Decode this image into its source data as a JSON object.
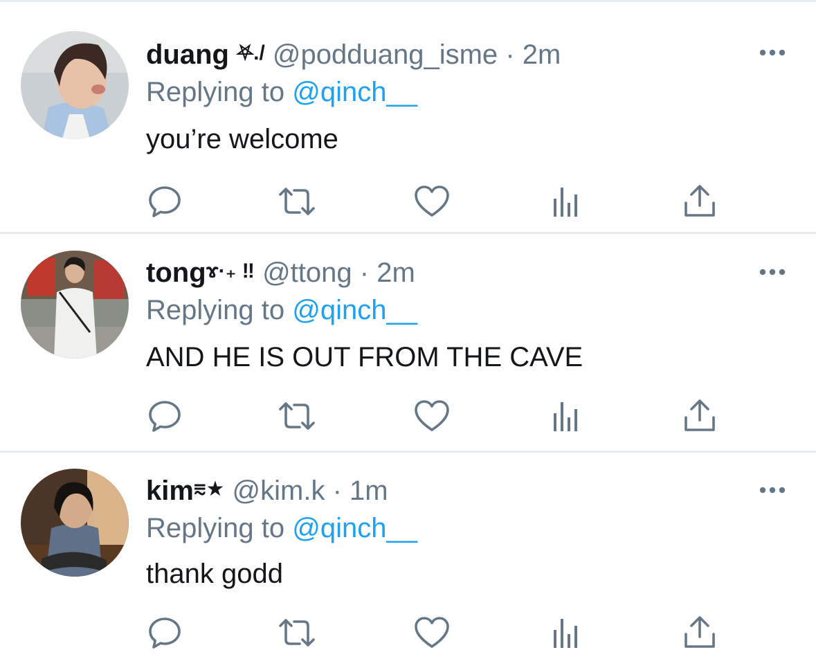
{
  "replying_prefix": "Replying to ",
  "colors": {
    "link": "#1da1f2",
    "secondary": "#657786",
    "primary_text": "#14171a",
    "divider": "#e6ecf0"
  },
  "action_icons": [
    "reply-icon",
    "retweet-icon",
    "like-icon",
    "stats-icon",
    "share-icon"
  ],
  "tweets": [
    {
      "name": "duang",
      "name_decoration": "⛧./",
      "handle": "@podduang_isme",
      "separator": "·",
      "time": "2m",
      "replying_to": "@qinch__",
      "text": "you’re welcome"
    },
    {
      "name": "tong",
      "name_decoration": "ɤ·₊ ‼",
      "handle": "@ttong",
      "separator": "·",
      "time": "2m",
      "replying_to": "@qinch__",
      "text": "AND HE IS OUT FROM THE CAVE"
    },
    {
      "name": "kim",
      "name_decoration": "⩳★",
      "handle": "@kim.k",
      "separator": "·",
      "time": "1m",
      "replying_to": "@qinch__",
      "text": "thank godd"
    }
  ]
}
